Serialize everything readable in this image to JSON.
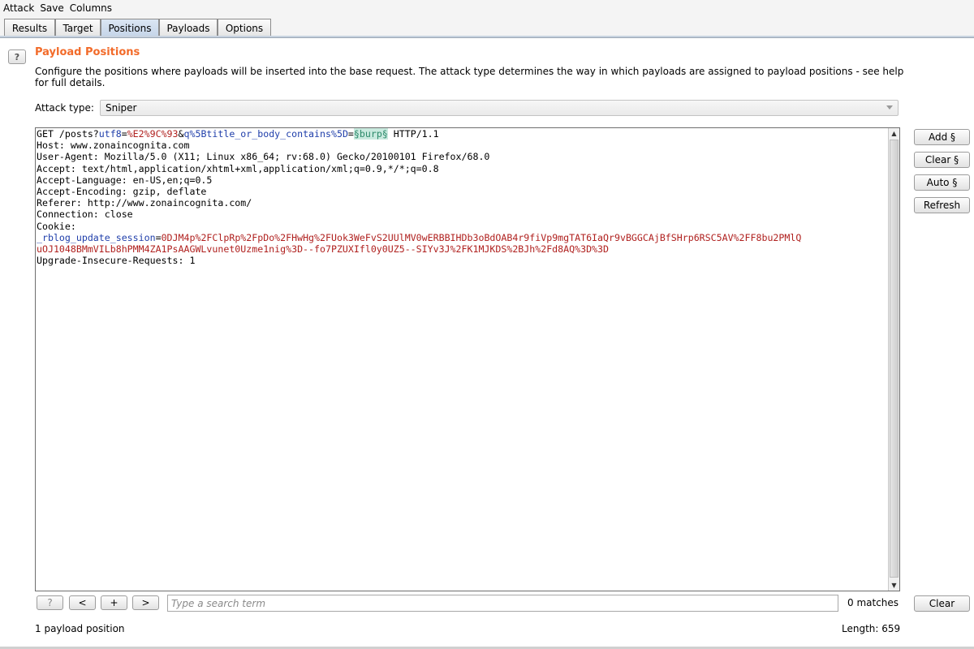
{
  "menu": [
    "Attack",
    "Save",
    "Columns"
  ],
  "tabs": [
    "Results",
    "Target",
    "Positions",
    "Payloads",
    "Options"
  ],
  "active_tab": "Positions",
  "help_label": "?",
  "section": {
    "title": "Payload Positions",
    "description": "Configure the positions where payloads will be inserted into the base request. The attack type determines the way in which payloads are assigned to payload positions - see help for full details."
  },
  "attack_type": {
    "label": "Attack type:",
    "value": "Sniper"
  },
  "request": {
    "line1": {
      "method_path": "GET /posts?",
      "p1_name": "utf8",
      "eq1": "=",
      "p1_value": "%E2%9C%93",
      "amp": "&",
      "p2_name": "q%5Btitle_or_body_contains%5D",
      "eq2": "=",
      "marker": "§burp§",
      "protocol": " HTTP/1.1"
    },
    "headers": [
      "Host: www.zonaincognita.com",
      "User-Agent: Mozilla/5.0 (X11; Linux x86_64; rv:68.0) Gecko/20100101 Firefox/68.0",
      "Accept: text/html,application/xhtml+xml,application/xml;q=0.9,*/*;q=0.8",
      "Accept-Language: en-US,en;q=0.5",
      "Accept-Encoding: gzip, deflate",
      "Referer: http://www.zonaincognita.com/",
      "Connection: close",
      "Cookie:"
    ],
    "cookie_name": "_rblog_update_session",
    "cookie_eq": "=",
    "cookie_value_line1": "0DJM4p%2FClpRp%2FpDo%2FHwHg%2FUok3WeFvS2UUlMV0wERBBIHDb3oBdOAB4r9fiVp9mgTAT6IaQr9vBGGCAjBfSHrp6RSC5AV%2FF8bu2PMlQ",
    "cookie_value_line2": "uOJ1048BMmVILb8hPMM4ZA1PsAAGWLvunet0Uzme1nig%3D--fo7PZUXIfl0y0UZ5--SIYv3J%2FK1MJKDS%2BJh%2Fd8AQ%3D%3D",
    "last_header": "Upgrade-Insecure-Requests: 1"
  },
  "side_buttons": [
    "Add §",
    "Clear §",
    "Auto §",
    "Refresh"
  ],
  "search": {
    "help": "?",
    "prev": "<",
    "add": "+",
    "next": ">",
    "placeholder": "Type a search term",
    "matches": "0 matches",
    "clear": "Clear"
  },
  "status": {
    "positions": "1 payload position",
    "length": "Length: 659"
  }
}
